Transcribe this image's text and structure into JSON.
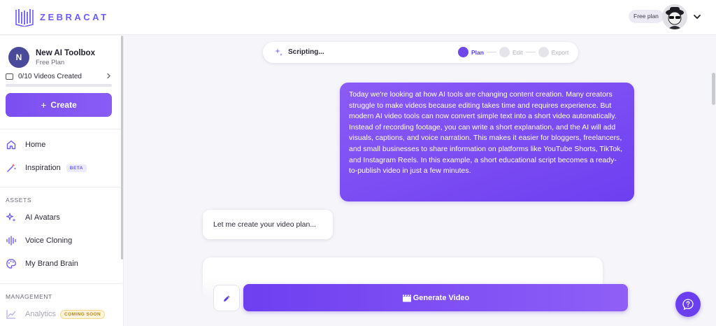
{
  "brand": {
    "name": "ZEBRACAT"
  },
  "header": {
    "plan_badge": "Free plan"
  },
  "sidebar": {
    "workspace": {
      "initial": "N",
      "name": "New AI Toolbox",
      "plan": "Free Plan"
    },
    "videos": {
      "label": "0/10 Videos Created",
      "progress": 0
    },
    "create_label": "Create",
    "nav": [
      {
        "label": "Home",
        "icon": "home-icon"
      },
      {
        "label": "Inspiration",
        "icon": "wand-icon",
        "badge": "BETA"
      }
    ],
    "assets_heading": "ASSETS",
    "assets": [
      {
        "label": "AI Avatars",
        "icon": "sparkle-icon"
      },
      {
        "label": "Voice Cloning",
        "icon": "waveform-icon"
      },
      {
        "label": "My Brand Brain",
        "icon": "palette-icon"
      }
    ],
    "management_heading": "MANAGEMENT",
    "management": [
      {
        "label": "Analytics",
        "icon": "chart-icon",
        "badge": "COMING SOON"
      }
    ]
  },
  "status": {
    "text": "Scripting...",
    "steps": [
      {
        "label": "Plan",
        "active": true
      },
      {
        "label": "Edit",
        "active": false
      },
      {
        "label": "Export",
        "active": false
      }
    ]
  },
  "chat": {
    "user_message": "Today we're looking at how AI tools are changing content creation. Many creators struggle to make videos because editing takes time and requires experience. But modern AI video tools can now convert simple text into a short video automatically. Instead of recording footage, you can write a short explanation, and the AI will add visuals, captions, and voice narration. This makes it easier for bloggers, freelancers, and small businesses to share information on platforms like YouTube Shorts, TikTok, and Instagram Reels. In this example, a short educational script becomes a ready-to-publish video in just a few minutes.",
    "bot_message": "Let me create your video plan..."
  },
  "actions": {
    "generate_label": "Generate Video"
  },
  "colors": {
    "accent": "#7048e8",
    "accent_light": "#8b5cf6",
    "badge_soon": "#b8861b"
  }
}
